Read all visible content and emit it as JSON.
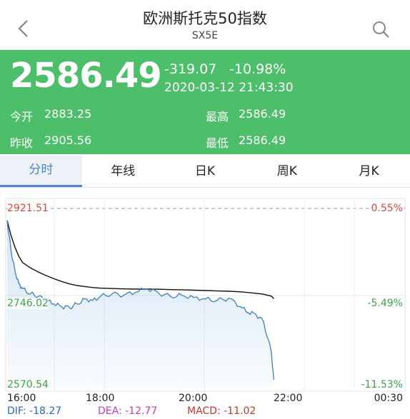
{
  "header": {
    "title": "欧洲斯托克50指数",
    "subtitle": "SX5E"
  },
  "quote": {
    "price": "2586.49",
    "change": "-319.07",
    "change_pct": "-10.98%",
    "time": "2020-03-12 21:43:30",
    "open_label": "今开",
    "open_value": "2883.25",
    "prev_close_label": "昨收",
    "prev_close_value": "2905.56",
    "high_label": "最高",
    "high_value": "2586.49",
    "low_label": "最低",
    "low_value": "2586.49"
  },
  "tabs": [
    {
      "label": "分时",
      "active": true
    },
    {
      "label": "年线",
      "active": false
    },
    {
      "label": "日K",
      "active": false
    },
    {
      "label": "周K",
      "active": false
    },
    {
      "label": "月K",
      "active": false
    }
  ],
  "chart": {
    "y_left": [
      "2921.51",
      "2746.02",
      "2570.54"
    ],
    "y_right": [
      "0.55%",
      "-5.49%",
      "-11.53%"
    ],
    "x_labels": [
      "16:00",
      "18:00",
      "20:00",
      "22:00",
      "00:30"
    ],
    "indicators": [
      {
        "label": "DIF: -18.27",
        "color": "#2a66c4"
      },
      {
        "label": "DEA: -12.77",
        "color": "#c23bb8"
      },
      {
        "label": "MACD: -11.02",
        "color": "#c0392b"
      }
    ],
    "colors": {
      "up": "#d9453b",
      "down": "#3aa24a",
      "price_line": "#3d7fc1",
      "avg_line": "#111111"
    }
  },
  "chart_data": {
    "type": "line",
    "x": [
      "16:00",
      "16:05",
      "16:10",
      "16:15",
      "16:20",
      "16:30",
      "16:40",
      "16:50",
      "17:00",
      "17:10",
      "17:20",
      "17:30",
      "17:40",
      "17:50",
      "18:00",
      "18:15",
      "18:30",
      "18:45",
      "19:00",
      "19:15",
      "19:30",
      "19:45",
      "20:00",
      "20:15",
      "20:30",
      "20:45",
      "21:00",
      "21:10",
      "21:20",
      "21:30",
      "21:40",
      "21:43"
    ],
    "series": [
      {
        "values": [
          2898,
          2840,
          2800,
          2775,
          2765,
          2755,
          2750,
          2742,
          2735,
          2730,
          2728,
          2735,
          2745,
          2742,
          2750,
          2755,
          2752,
          2758,
          2765,
          2756,
          2750,
          2752,
          2748,
          2745,
          2742,
          2746,
          2730,
          2718,
          2715,
          2700,
          2640,
          2587
        ]
      }
    ],
    "ylim": [
      2570.54,
      2921.51
    ],
    "ylabels_left": [
      "2921.51",
      "2746.02",
      "2570.54"
    ],
    "ylabels_right": [
      "0.55%",
      "-5.49%",
      "-11.53%"
    ],
    "xlabels": [
      "16:00",
      "18:00",
      "20:00",
      "22:00",
      "00:30"
    ]
  }
}
